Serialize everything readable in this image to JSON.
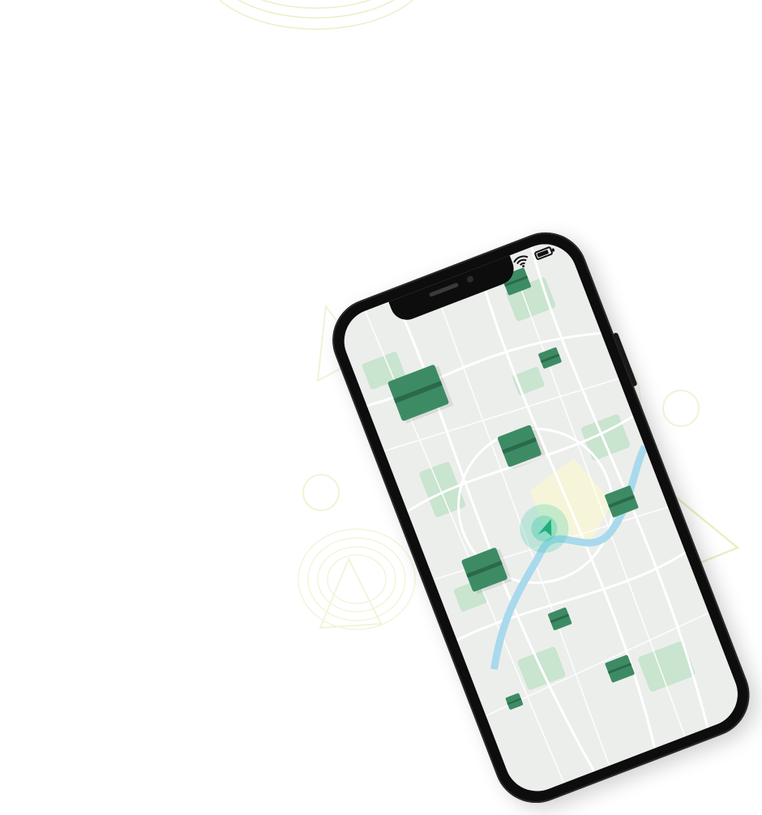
{
  "scene": {
    "background": "#ffffff",
    "accent": "#3d8b64",
    "river_color": "#a9d9ec",
    "highlight_color": "#34c9a2"
  },
  "phone": {
    "status": {
      "wifi": "wifi-icon",
      "battery_level": 0.9
    }
  },
  "map": {
    "markers": [
      "parcel-icon",
      "parcel-icon",
      "parcel-icon",
      "parcel-icon",
      "parcel-icon",
      "parcel-icon",
      "parcel-icon",
      "parcel-icon",
      "parcel-icon"
    ],
    "current_location": "navigation-arrow-icon"
  }
}
